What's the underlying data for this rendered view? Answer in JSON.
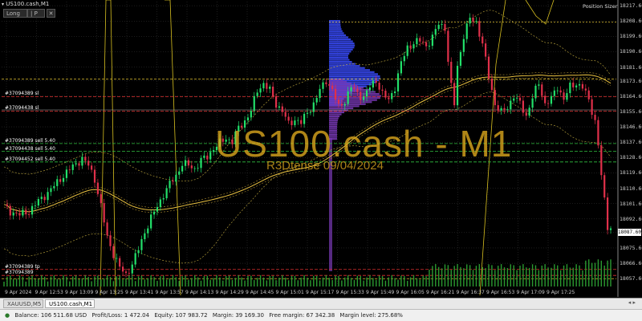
{
  "window": {
    "title": "US100.cash,M1"
  },
  "trade_panel": {
    "long_label": "Long",
    "panel_label": "| P"
  },
  "position_sizer": {
    "label": "Position Sizer"
  },
  "watermark": {
    "symbol": "US100.cash - M1",
    "subtitle": "R3Dtense 09/04/2024"
  },
  "current_price": "18087.60",
  "chart_data": {
    "type": "candlestick",
    "title": "US100.cash,M1",
    "ylim": [
      18053,
      18220
    ],
    "y_ticks": [
      "18217.60",
      "18208.60",
      "18199.60",
      "18190.60",
      "18181.60",
      "18173.60",
      "18164.60",
      "18155.60",
      "18146.60",
      "18137.60",
      "18128.60",
      "18119.60",
      "18110.60",
      "18101.60",
      "18092.60",
      "18084.60",
      "18075.60",
      "18066.60",
      "18057.60"
    ],
    "x_ticks": [
      "9 Apr 2024",
      "9 Apr 12:53",
      "9 Apr 13:09",
      "9 Apr 13:25",
      "9 Apr 13:41",
      "9 Apr 13:57",
      "9 Apr 14:13",
      "9 Apr 14:29",
      "9 Apr 14:45",
      "9 Apr 15:01",
      "9 Apr 15:17",
      "9 Apr 15:33",
      "9 Apr 15:49",
      "9 Apr 16:05",
      "9 Apr 16:21",
      "9 Apr 16:37",
      "9 Apr 16:53",
      "9 Apr 17:09",
      "9 Apr 17:25"
    ],
    "close_path": [
      [
        0,
        18100
      ],
      [
        2,
        18097
      ],
      [
        5,
        18095
      ],
      [
        8,
        18097
      ],
      [
        11,
        18103
      ],
      [
        14,
        18108
      ],
      [
        17,
        18114
      ],
      [
        20,
        18120
      ],
      [
        23,
        18125
      ],
      [
        25,
        18128
      ],
      [
        27,
        18124
      ],
      [
        29,
        18116
      ],
      [
        31,
        18100
      ],
      [
        33,
        18082
      ],
      [
        35,
        18072
      ],
      [
        37,
        18064
      ],
      [
        39,
        18060
      ],
      [
        41,
        18066
      ],
      [
        43,
        18075
      ],
      [
        45,
        18085
      ],
      [
        47,
        18093
      ],
      [
        49,
        18100
      ],
      [
        51,
        18107
      ],
      [
        53,
        18113
      ],
      [
        55,
        18118
      ],
      [
        57,
        18125
      ],
      [
        59,
        18124
      ],
      [
        61,
        18122
      ],
      [
        63,
        18127
      ],
      [
        65,
        18129
      ],
      [
        67,
        18134
      ],
      [
        69,
        18137
      ],
      [
        71,
        18140
      ],
      [
        73,
        18138
      ],
      [
        75,
        18146
      ],
      [
        77,
        18150
      ],
      [
        79,
        18156
      ],
      [
        81,
        18168
      ],
      [
        83,
        18172
      ],
      [
        85,
        18168
      ],
      [
        87,
        18160
      ],
      [
        89,
        18156
      ],
      [
        91,
        18148
      ],
      [
        93,
        18151
      ],
      [
        95,
        18149
      ],
      [
        97,
        18155
      ],
      [
        99,
        18160
      ],
      [
        101,
        18168
      ],
      [
        103,
        18174
      ],
      [
        105,
        18168
      ],
      [
        107,
        18158
      ],
      [
        109,
        18162
      ],
      [
        111,
        18170
      ],
      [
        113,
        18166
      ],
      [
        115,
        18164
      ],
      [
        117,
        18170
      ],
      [
        119,
        18174
      ],
      [
        121,
        18166
      ],
      [
        123,
        18162
      ],
      [
        125,
        18170
      ],
      [
        127,
        18184
      ],
      [
        129,
        18193
      ],
      [
        131,
        18196
      ],
      [
        133,
        18197
      ],
      [
        135,
        18194
      ],
      [
        137,
        18199
      ],
      [
        139,
        18207
      ],
      [
        141,
        18205
      ],
      [
        142,
        18185
      ],
      [
        143,
        18170
      ],
      [
        144,
        18160
      ],
      [
        145,
        18182
      ],
      [
        147,
        18200
      ],
      [
        149,
        18210
      ],
      [
        151,
        18208
      ],
      [
        153,
        18195
      ],
      [
        155,
        18176
      ],
      [
        157,
        18160
      ],
      [
        159,
        18155
      ],
      [
        161,
        18158
      ],
      [
        163,
        18165
      ],
      [
        165,
        18160
      ],
      [
        167,
        18153
      ],
      [
        169,
        18164
      ],
      [
        171,
        18172
      ],
      [
        173,
        18160
      ],
      [
        175,
        18163
      ],
      [
        177,
        18170
      ],
      [
        179,
        18163
      ],
      [
        181,
        18170
      ],
      [
        183,
        18172
      ],
      [
        185,
        18170
      ],
      [
        187,
        18162
      ],
      [
        189,
        18150
      ],
      [
        190,
        18136
      ],
      [
        191,
        18118
      ],
      [
        192,
        18103
      ],
      [
        193,
        18088
      ]
    ],
    "bid_line": 18156.5,
    "ask_line": 18159.7,
    "order_lines": [
      18164.3,
      18155.8,
      18136.8,
      18132.2,
      18126.0,
      18063.0,
      18059.5
    ],
    "session_high": 18208.0,
    "range_high_line": 18174.6,
    "range_low_line": 18057.6
  },
  "order_labels": [
    "#37094389 sl",
    "#37094438 sl",
    "#37094389 sell 5.40",
    "#37094438 sell 5.40",
    "#37094452 sell 5.40",
    "#37094389 tp",
    "#37094389"
  ],
  "tabs": [
    {
      "label": "XAUUSD,M5",
      "active": false
    },
    {
      "label": "US100.cash,M1",
      "active": true
    }
  ],
  "status": {
    "balance": "Balance: 106 511.68 USD",
    "profit_loss": "Profit/Loss: 1 472.04",
    "equity": "Equity: 107 983.72",
    "margin": "Margin: 39 169.30",
    "free_margin": "Free margin: 67 342.38",
    "margin_level": "Margin level: 275.68%"
  },
  "colors": {
    "up": "#22e06a",
    "down": "#e0304a",
    "grid": "#3a3a3a",
    "accent": "#e0b020",
    "profile": "#3a4cff"
  }
}
